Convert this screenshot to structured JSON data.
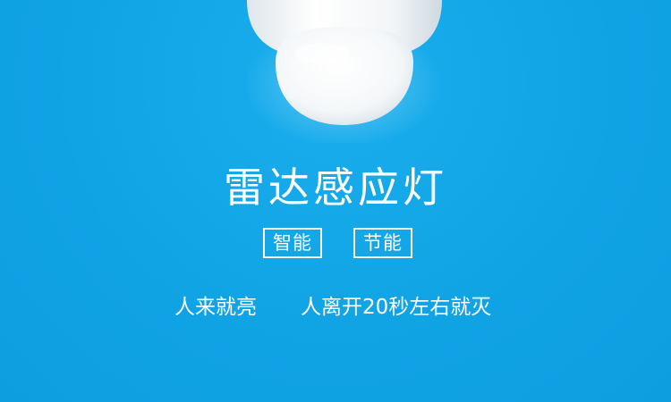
{
  "banner": {
    "background_color": "#12a6e6",
    "product_image": "led-bulb-icon",
    "title": "雷达感应灯",
    "tags": [
      "智能",
      "节能"
    ],
    "descriptions": [
      "人来就亮",
      "人离开20秒左右就灭"
    ]
  }
}
